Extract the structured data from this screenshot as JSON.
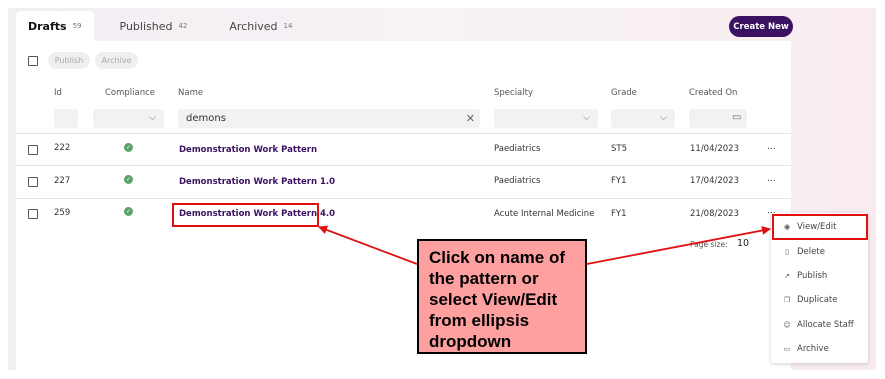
{
  "tabs": [
    {
      "label": "Drafts",
      "count": "59"
    },
    {
      "label": "Published",
      "count": "42"
    },
    {
      "label": "Archived",
      "count": "14"
    }
  ],
  "create_button": "Create New",
  "toolbar": {
    "publish": "Publish",
    "archive": "Archive"
  },
  "columns": {
    "id": "Id",
    "compliance": "Compliance",
    "name": "Name",
    "specialty": "Specialty",
    "grade": "Grade",
    "created_on": "Created On"
  },
  "filters": {
    "name_value": "demons"
  },
  "rows": [
    {
      "id": "222",
      "name": "Demonstration Work Pattern",
      "specialty": "Paediatrics",
      "grade": "ST5",
      "created": "11/04/2023",
      "actions": "..."
    },
    {
      "id": "227",
      "name": "Demonstration Work Pattern 1.0",
      "specialty": "Paediatrics",
      "grade": "FY1",
      "created": "17/04/2023",
      "actions": "..."
    },
    {
      "id": "259",
      "name": "Demonstration Work Pattern 4.0",
      "specialty": "Acute Internal Medicine",
      "grade": "FY1",
      "created": "21/08/2023",
      "actions": "..."
    }
  ],
  "pagination": {
    "label": "Page size:",
    "value": "10"
  },
  "menu": [
    {
      "label": "View/Edit",
      "icon": "eye-icon"
    },
    {
      "label": "Delete",
      "icon": "trash-icon"
    },
    {
      "label": "Publish",
      "icon": "arrow-up-right-icon"
    },
    {
      "label": "Duplicate",
      "icon": "copy-icon"
    },
    {
      "label": "Allocate Staff",
      "icon": "users-icon"
    },
    {
      "label": "Archive",
      "icon": "archive-box-icon"
    }
  ],
  "callout": "Click on name of the pattern or select View/Edit from ellipsis dropdown",
  "colors": {
    "brand": "#3b1261",
    "highlight": "#e01010",
    "callout_bg": "#ffa0a0",
    "success": "#5aa469"
  }
}
